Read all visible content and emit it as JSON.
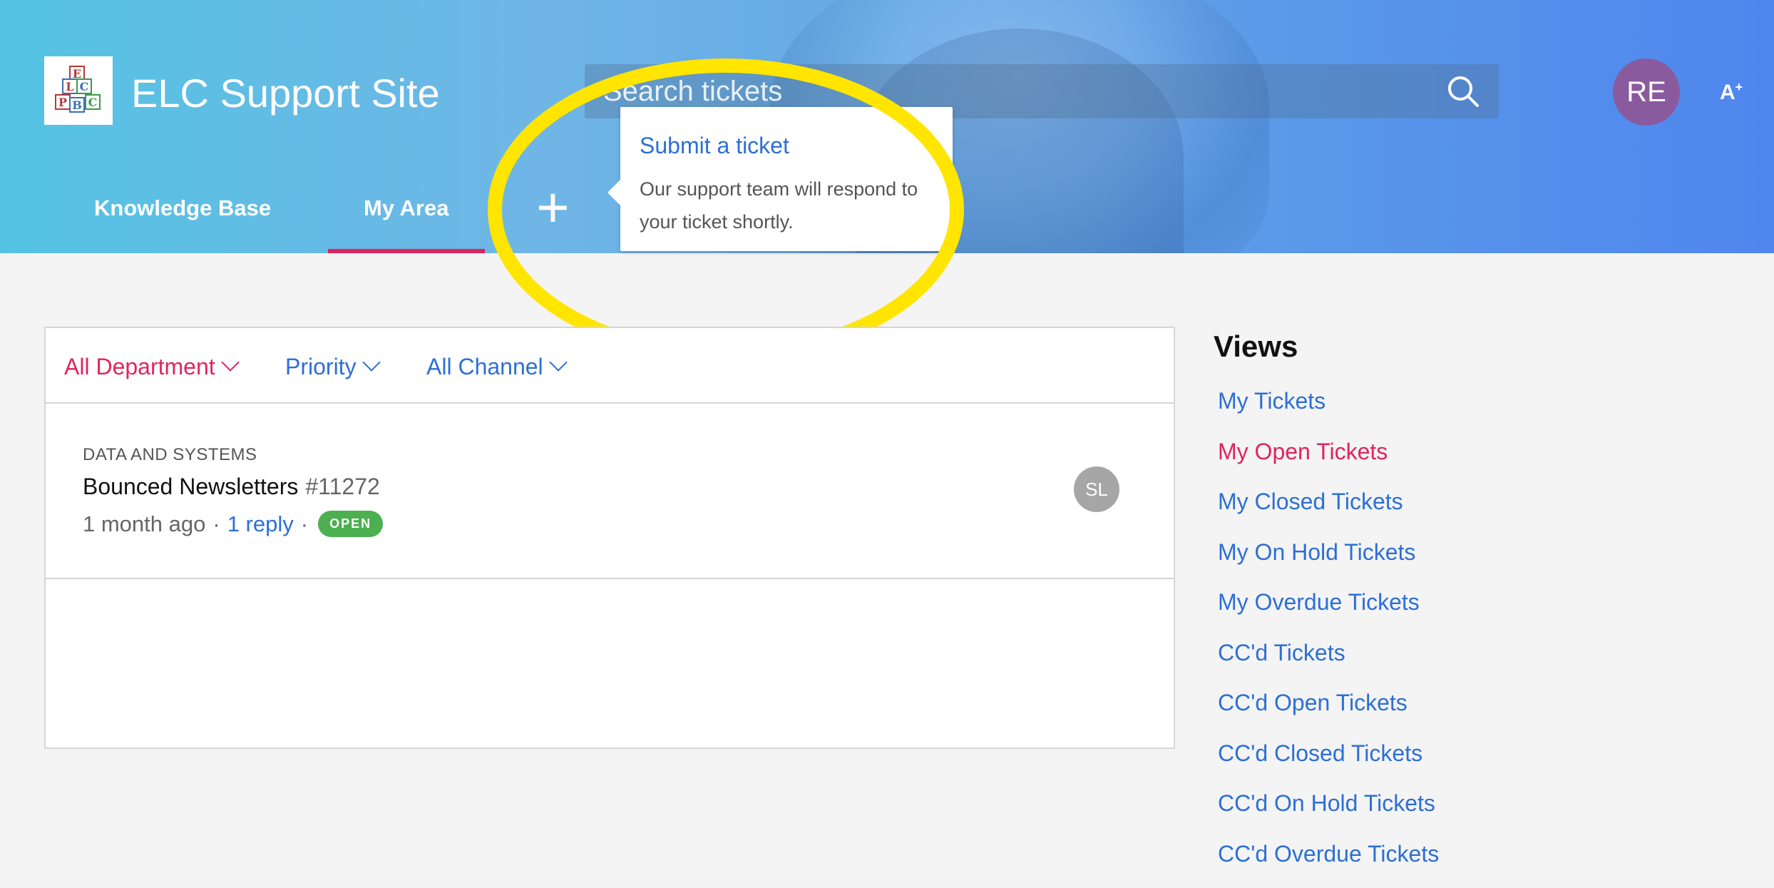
{
  "header": {
    "site_title": "ELC Support Site",
    "logo_letters": [
      "E",
      "L",
      "C",
      "P",
      "B",
      "C"
    ],
    "search_placeholder": "Search tickets",
    "avatar_initials": "RE",
    "font_size_button": "A",
    "font_size_button_sup": "+",
    "nav": {
      "knowledge_base": "Knowledge Base",
      "my_area": "My Area",
      "new_ticket": "+"
    },
    "colors": {
      "accent_underline": "#e0245e",
      "avatar_bg": "#8a5a9e"
    }
  },
  "popover": {
    "title": "Submit a ticket",
    "body": "Our support team will respond to your ticket shortly."
  },
  "annotation": {
    "color": "#ffe500"
  },
  "filters": {
    "department": "All Department",
    "priority": "Priority",
    "channel": "All Channel"
  },
  "tickets": [
    {
      "department": "DATA AND SYSTEMS",
      "title": "Bounced Newsletters",
      "number": "#11272",
      "age": "1 month ago",
      "replies": "1 reply",
      "status": "OPEN",
      "assignee_initials": "SL"
    }
  ],
  "views": {
    "title": "Views",
    "items": [
      {
        "label": "My Tickets",
        "active": false
      },
      {
        "label": "My Open Tickets",
        "active": true
      },
      {
        "label": "My Closed Tickets",
        "active": false
      },
      {
        "label": "My On Hold Tickets",
        "active": false
      },
      {
        "label": "My Overdue Tickets",
        "active": false
      },
      {
        "label": "CC'd Tickets",
        "active": false
      },
      {
        "label": "CC'd Open Tickets",
        "active": false
      },
      {
        "label": "CC'd Closed Tickets",
        "active": false
      },
      {
        "label": "CC'd On Hold Tickets",
        "active": false
      },
      {
        "label": "CC'd Overdue Tickets",
        "active": false
      }
    ]
  }
}
